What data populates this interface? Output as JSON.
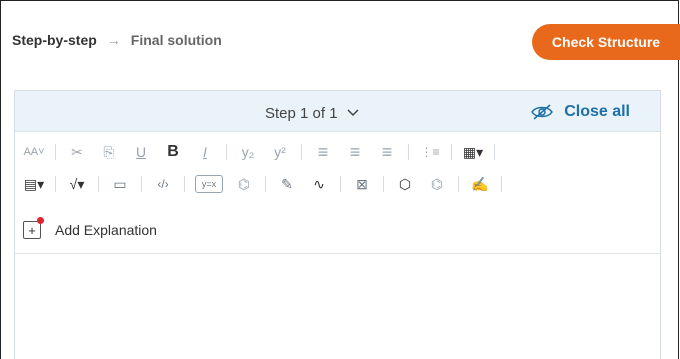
{
  "breadcrumb": {
    "step1": "Step-by-step",
    "arrow": "→",
    "step2": "Final solution"
  },
  "check_button": {
    "label": "Check Structure",
    "color": "#e8691c"
  },
  "step_header": {
    "label": "Step 1 of 1",
    "close_all": "Close all",
    "accent": "#1e6fa6"
  },
  "toolbar_row1": [
    {
      "name": "font-size-icon",
      "glyph": "AA˅"
    },
    {
      "name": "cut-icon",
      "glyph": "✂"
    },
    {
      "name": "paste-icon",
      "glyph": "⎘"
    },
    {
      "name": "underline-icon",
      "glyph": "U"
    },
    {
      "name": "bold-icon",
      "glyph": "B"
    },
    {
      "name": "italic-icon",
      "glyph": "I"
    },
    {
      "name": "subscript-icon",
      "glyph": "y₂"
    },
    {
      "name": "superscript-icon",
      "glyph": "y²"
    },
    {
      "name": "align-left-icon",
      "glyph": "≡"
    },
    {
      "name": "align-center-icon",
      "glyph": "≡"
    },
    {
      "name": "align-right-icon",
      "glyph": "≡"
    },
    {
      "name": "list-icon",
      "glyph": "⋮≡"
    },
    {
      "name": "table-icon",
      "glyph": "▦▾"
    }
  ],
  "toolbar_row2": [
    {
      "name": "special-chars-icon",
      "glyph": "▤▾"
    },
    {
      "name": "formula-icon",
      "glyph": "√▾"
    },
    {
      "name": "image-icon",
      "glyph": "▭"
    },
    {
      "name": "code-icon",
      "glyph": "‹/›"
    },
    {
      "name": "equation-box-icon",
      "glyph": "y=x"
    },
    {
      "name": "chemistry-icon",
      "glyph": "⌬"
    },
    {
      "name": "drawing-icon",
      "glyph": "✎"
    },
    {
      "name": "graph-icon",
      "glyph": "∿"
    },
    {
      "name": "matrix-icon",
      "glyph": "⊠"
    },
    {
      "name": "shape-icon",
      "glyph": "⬡"
    },
    {
      "name": "molecule-icon",
      "glyph": "⌬"
    },
    {
      "name": "signature-icon",
      "glyph": "✍"
    }
  ],
  "add_explanation": {
    "label": "Add Explanation",
    "plus": "+"
  }
}
